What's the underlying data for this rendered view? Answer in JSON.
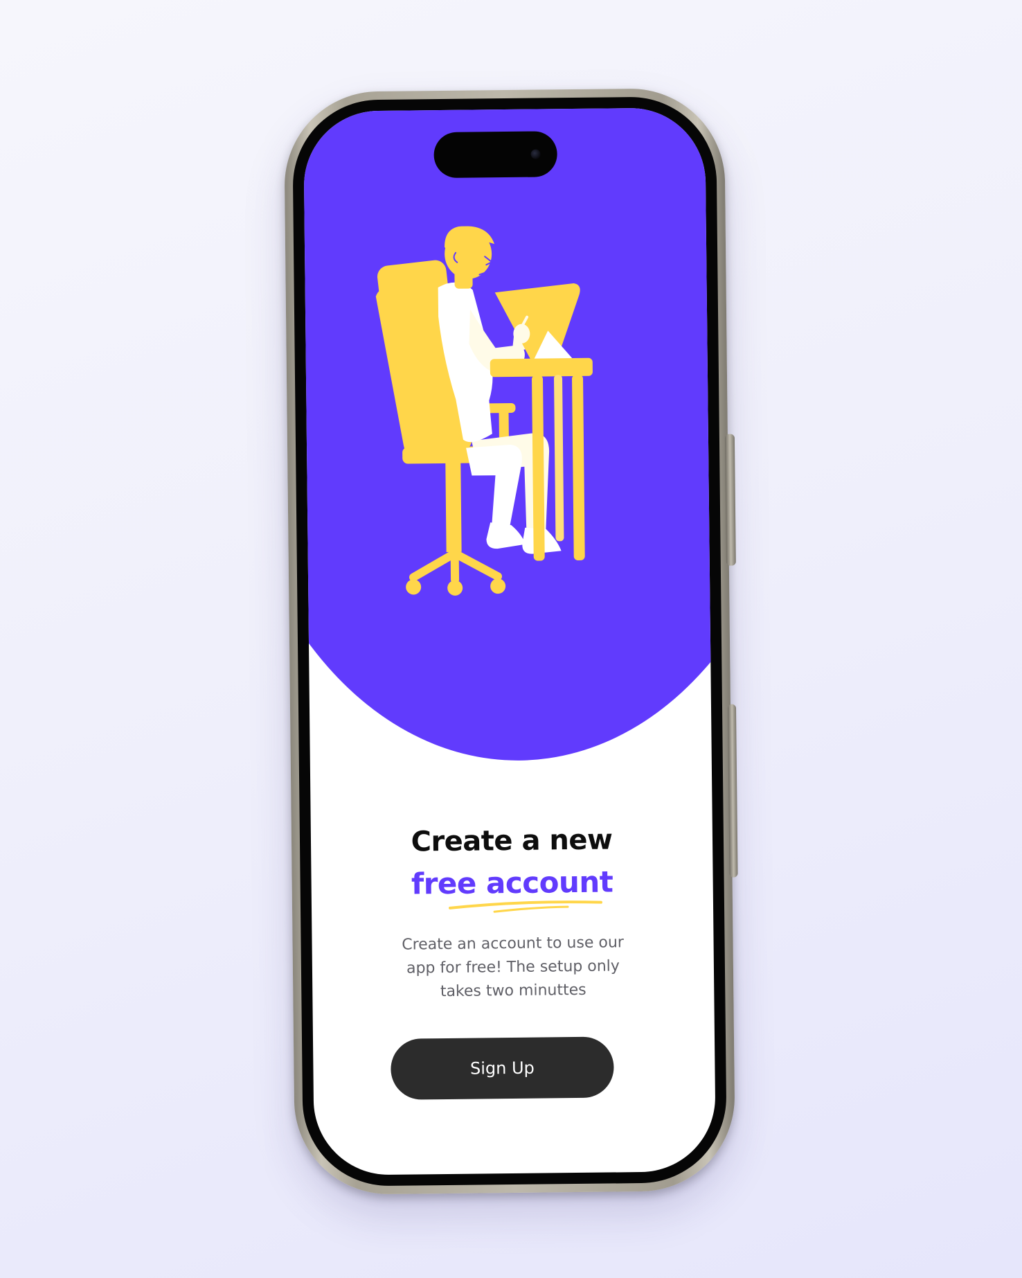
{
  "colors": {
    "accent": "#613bfd",
    "illustration_yellow": "#ffd64a",
    "button_dark": "#2c2c2c",
    "text_dark": "#0d0d0d",
    "text_muted": "#5f5f66"
  },
  "onboarding": {
    "headline_line1": "Create a new",
    "headline_accent": "free account",
    "description": "Create an account to use our app for free! The setup only takes two minuttes",
    "signup_label": "Sign Up"
  },
  "illustration": {
    "subject": "person-sitting-at-drafting-desk-illustration"
  }
}
